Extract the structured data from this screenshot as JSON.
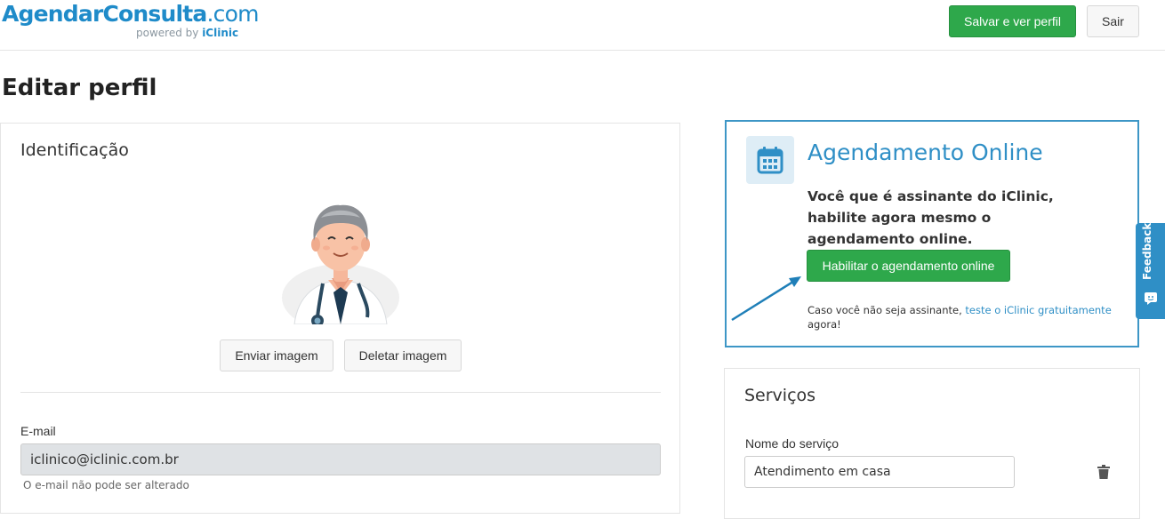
{
  "header": {
    "logo_brand": "AgendarConsulta",
    "logo_tld": ".com",
    "logo_powered": "powered by ",
    "logo_powered_brand": "iClinic",
    "save_label": "Salvar e ver perfil",
    "exit_label": "Sair"
  },
  "page": {
    "title": "Editar perfil"
  },
  "identification": {
    "title": "Identificação",
    "avatar_icon": "doctor-avatar",
    "upload_label": "Enviar imagem",
    "delete_label": "Deletar imagem",
    "email_label": "E-mail",
    "email_value": "iclinico@iclinic.com.br",
    "email_hint": "O e-mail não pode ser alterado"
  },
  "promo": {
    "icon": "calendar-icon",
    "title": "Agendamento Online",
    "text": "Você que é assinante do iClinic, habilite agora mesmo o agendamento online.",
    "button_label": "Habilitar o agendamento online",
    "small_prefix": "Caso você não seja assinante, ",
    "small_link": "teste o iClinic gratuitamente",
    "small_suffix": " agora!"
  },
  "services": {
    "title": "Serviços",
    "name_label": "Nome do serviço",
    "name_value": "Atendimento em casa",
    "delete_icon": "trash-icon"
  },
  "feedback": {
    "label": "Feedback"
  },
  "colors": {
    "brand": "#1f8bc9",
    "green": "#2ea84b",
    "promo_border": "#3d96c6"
  }
}
